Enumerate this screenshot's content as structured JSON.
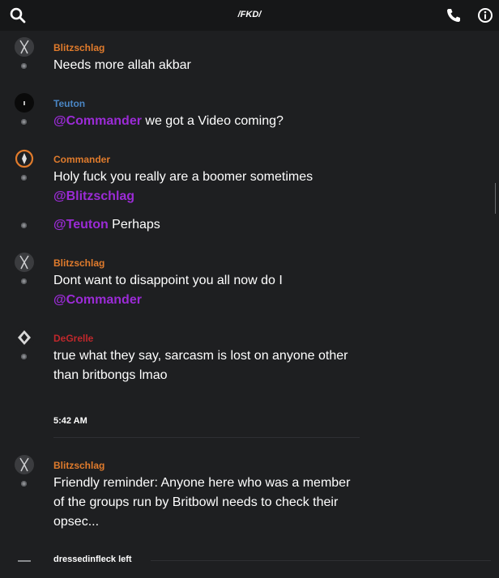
{
  "header": {
    "title": "/FKD/",
    "icons": [
      "search-icon",
      "phone-icon",
      "info-icon"
    ]
  },
  "colors": {
    "orange_user": "#e07b2c",
    "blue_user": "#4a86c5",
    "red_user": "#c0282c",
    "mention": "#9b2bd6"
  },
  "messages": [
    {
      "author": "Blitzschlag",
      "line1": "Needs more allah akbar"
    },
    {
      "author": "Teuton",
      "mention": "@Commander",
      "line1_after": " we got a Video coming?"
    },
    {
      "author": "Commander",
      "line1": "Holy fuck you really are a boomer sometimes",
      "mention": "@Blitzschlag"
    },
    {
      "mention": "@Teuton",
      "line1_after": " Perhaps"
    },
    {
      "author": "Blitzschlag",
      "line1": "Dont want to disappoint you all now do I",
      "mention": "@Commander"
    },
    {
      "author": "DeGrelle",
      "line1": "true what they say, sarcasm is lost on anyone other",
      "line2": "than britbongs lmao"
    },
    {
      "author": "Blitzschlag",
      "line1": "Friendly reminder: Anyone here who was a member",
      "line2": "of the groups run by Britbowl needs to check their",
      "line3": "opsec..."
    }
  ],
  "timestamp": "5:42 AM",
  "system_event": "dressedinfleck left"
}
